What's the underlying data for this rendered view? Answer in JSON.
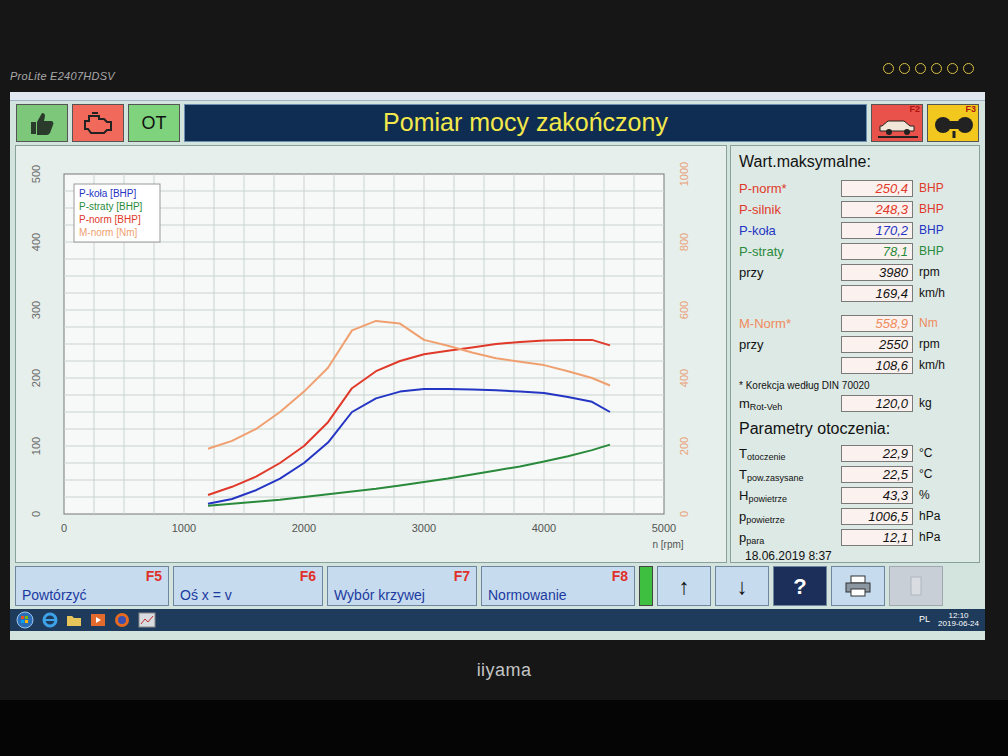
{
  "monitor": {
    "model": "ProLite E2407HDSV",
    "brand": "iiyama"
  },
  "indicators": [
    {
      "kind": "thumb",
      "color": "#7cc77a"
    },
    {
      "kind": "engine",
      "color": "#f0695a"
    },
    {
      "kind": "text",
      "label": "OT",
      "color": "#7ed37c"
    }
  ],
  "title": "Pomiar mocy zakończony",
  "top_keys": [
    {
      "kind": "lift",
      "key": "F2",
      "color": "#e8524a"
    },
    {
      "kind": "rollers",
      "key": "F3",
      "color": "#f2c81e"
    }
  ],
  "chart": {
    "y_left_ticks": [
      "0",
      "100",
      "200",
      "300",
      "400",
      "500"
    ],
    "y_right_ticks": [
      "0",
      "200",
      "400",
      "600",
      "800",
      "1000"
    ],
    "x_ticks": [
      "0",
      "1000",
      "2000",
      "3000",
      "4000",
      "5000"
    ],
    "x_label": "n [rpm]",
    "rpm": [
      1200,
      1400,
      1600,
      1800,
      2000,
      2200,
      2400,
      2600,
      2800,
      3000,
      3200,
      3400,
      3600,
      3800,
      4000,
      4200,
      4400,
      4550
    ],
    "series": [
      {
        "label": "P-koła [BHP]",
        "axis": "left",
        "color": "#2435c4",
        "values": [
          15,
          22,
          35,
          52,
          75,
          105,
          150,
          170,
          180,
          184,
          184,
          183,
          182,
          180,
          178,
          172,
          165,
          150
        ]
      },
      {
        "label": "P-straty [BHP]",
        "axis": "left",
        "color": "#2a8a3c",
        "values": [
          12,
          15,
          18,
          21,
          25,
          29,
          33,
          37,
          42,
          47,
          52,
          58,
          64,
          70,
          77,
          85,
          94,
          102
        ]
      },
      {
        "label": "P-norm [BHP]",
        "axis": "left",
        "color": "#e0392a",
        "values": [
          28,
          40,
          55,
          75,
          100,
          135,
          185,
          210,
          225,
          235,
          240,
          245,
          250,
          253,
          255,
          256,
          256,
          248
        ]
      },
      {
        "label": "M-norm [Nm]",
        "axis": "right",
        "color": "#f0a070",
        "values": [
          192,
          215,
          250,
          300,
          360,
          430,
          540,
          568,
          560,
          512,
          495,
          475,
          458,
          448,
          438,
          420,
          400,
          378
        ]
      }
    ]
  },
  "max_values": {
    "title": "Wart.maksymalne:",
    "groups": [
      {
        "rows": [
          {
            "label": "P-norm*",
            "value": "250,4",
            "unit": "BHP",
            "color": "#e0392a"
          },
          {
            "label": "P-silnik",
            "value": "248,3",
            "unit": "BHP",
            "color": "#e0392a"
          },
          {
            "label": "P-koła",
            "value": "170,2",
            "unit": "BHP",
            "color": "#2435c4"
          },
          {
            "label": "P-straty",
            "value": "78,1",
            "unit": "BHP",
            "color": "#2a8a3c"
          },
          {
            "label": "przy",
            "value": "3980",
            "unit": "rpm",
            "color": "#111111"
          },
          {
            "value": "169,4",
            "unit": "km/h",
            "color": "#111111"
          }
        ]
      },
      {
        "rows": [
          {
            "label": "M-Norm*",
            "value": "558,9",
            "unit": "Nm",
            "color": "#f08a5a"
          },
          {
            "label": "przy",
            "value": "2550",
            "unit": "rpm",
            "color": "#111111"
          },
          {
            "value": "108,6",
            "unit": "km/h",
            "color": "#111111"
          }
        ]
      }
    ],
    "footnote": "* Korekcja według DIN 70020",
    "mass": {
      "label": "m",
      "sub": "Rot-Veh",
      "value": "120,0",
      "unit": "kg"
    }
  },
  "ambient": {
    "title": "Parametry otoczenia:",
    "rows": [
      {
        "label": "T",
        "sub": "otoczenie",
        "value": "22,9",
        "unit": "°C"
      },
      {
        "label": "T",
        "sub": "pow.zasysane",
        "value": "22,5",
        "unit": "°C"
      },
      {
        "label": "H",
        "sub": "powietrze",
        "value": "43,3",
        "unit": "%"
      },
      {
        "label": "p",
        "sub": "powietrze",
        "value": "1006,5",
        "unit": "hPa"
      },
      {
        "label": "p",
        "sub": "para",
        "value": "12,1",
        "unit": "hPa"
      }
    ]
  },
  "timestamp": "18.06.2019 8:37",
  "buttons": [
    {
      "label": "Powtórzyć",
      "key": "F5"
    },
    {
      "label": "Oś x = v",
      "key": "F6"
    },
    {
      "label": "Wybór krzywej",
      "key": "F7"
    },
    {
      "label": "Normowanie",
      "key": "F8"
    }
  ],
  "signal": {
    "level": 1
  },
  "icon_buttons": [
    {
      "kind": "text",
      "label": "↑",
      "disabled": false
    },
    {
      "kind": "text",
      "label": "↓",
      "disabled": false
    },
    {
      "kind": "help",
      "label": "?",
      "disabled": false
    },
    {
      "kind": "printer",
      "disabled": false
    },
    {
      "kind": "blank",
      "disabled": true
    }
  ],
  "taskbar": {
    "lang": "PL",
    "time": "12:10",
    "date": "2019-06-24"
  }
}
